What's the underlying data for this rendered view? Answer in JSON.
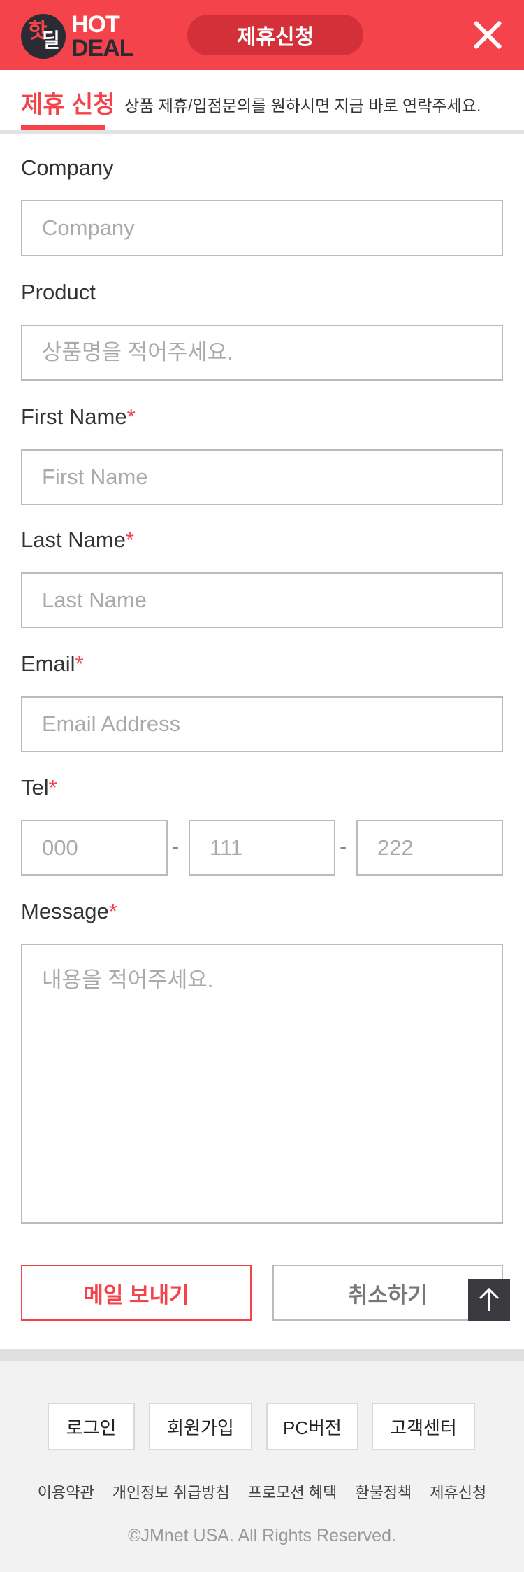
{
  "header": {
    "logo_korean_1": "핫",
    "logo_korean_2": "딜",
    "logo_hot": "HOT",
    "logo_deal": "DEAL",
    "title": "제휴신청",
    "close_icon": "close-icon"
  },
  "section": {
    "title": "제휴 신청",
    "description": "상품 제휴/입점문의를 원하시면 지금 바로 연락주세요."
  },
  "form": {
    "company": {
      "label": "Company",
      "placeholder": "Company",
      "value": ""
    },
    "product": {
      "label": "Product",
      "placeholder": "상품명을 적어주세요.",
      "value": ""
    },
    "first_name": {
      "label": "First Name",
      "required": "*",
      "placeholder": "First Name",
      "value": ""
    },
    "last_name": {
      "label": "Last Name",
      "required": "*",
      "placeholder": "Last Name",
      "value": ""
    },
    "email": {
      "label": "Email",
      "required": "*",
      "placeholder": "Email Address",
      "value": ""
    },
    "tel": {
      "label": "Tel",
      "required": "*",
      "placeholder_1": "000",
      "placeholder_2": "111",
      "placeholder_3": "222",
      "separator": "-"
    },
    "message": {
      "label": "Message",
      "required": "*",
      "placeholder": "내용을 적어주세요.",
      "value": ""
    },
    "send_label": "메일 보내기",
    "cancel_label": "취소하기"
  },
  "footer": {
    "buttons": [
      "로그인",
      "회원가입",
      "PC버전",
      "고객센터"
    ],
    "links": [
      "이용약관",
      "개인정보 취급방침",
      "프로모션 혜택",
      "환불정책",
      "제휴신청"
    ],
    "copyright": "©JMnet USA. All Rights Reserved."
  },
  "colors": {
    "brand_red": "#f5434c",
    "dark": "#2b2b33"
  }
}
